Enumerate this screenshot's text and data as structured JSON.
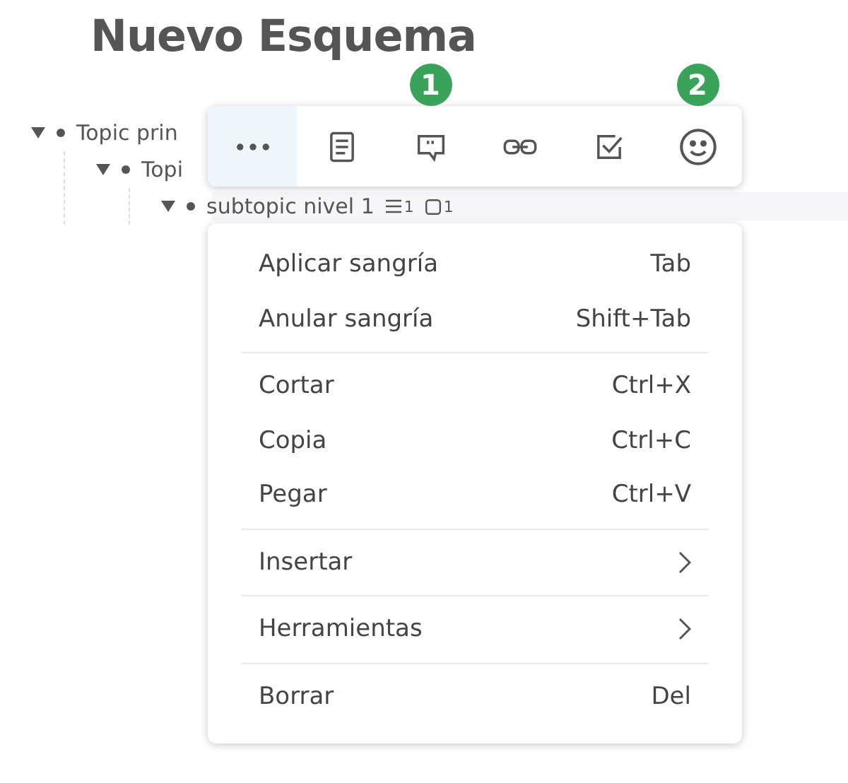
{
  "title": "Nuevo Esquema",
  "tree": [
    {
      "label": "Topic prin",
      "expanded": true,
      "children": [
        {
          "label": "Topi",
          "expanded": true,
          "children": [
            {
              "label": "subtopic nivel 1",
              "expanded": true,
              "tasks": "1",
              "comments": "1"
            }
          ]
        }
      ]
    }
  ],
  "toolbar": [
    {
      "kind": "more",
      "selected": true
    },
    {
      "kind": "note",
      "selected": false
    },
    {
      "kind": "comment",
      "selected": false,
      "badge": "1"
    },
    {
      "kind": "link",
      "selected": false
    },
    {
      "kind": "task",
      "selected": false
    },
    {
      "kind": "emoji",
      "selected": false,
      "badge": "2"
    }
  ],
  "menu": [
    [
      {
        "label": "Aplicar sangría",
        "shortcut": "Tab",
        "kind": "shortcut"
      },
      {
        "label": "Anular sangría",
        "shortcut": "Shift+Tab",
        "kind": "shortcut"
      }
    ],
    [
      {
        "label": "Cortar",
        "shortcut": "Ctrl+X",
        "kind": "shortcut"
      },
      {
        "label": "Copia",
        "shortcut": "Ctrl+C",
        "kind": "shortcut"
      },
      {
        "label": "Pegar",
        "shortcut": "Ctrl+V",
        "kind": "shortcut"
      }
    ],
    [
      {
        "label": "Insertar",
        "kind": "submenu"
      }
    ],
    [
      {
        "label": "Herramientas",
        "kind": "submenu"
      }
    ],
    [
      {
        "label": "Borrar",
        "shortcut": "Del",
        "kind": "shortcut"
      }
    ]
  ]
}
